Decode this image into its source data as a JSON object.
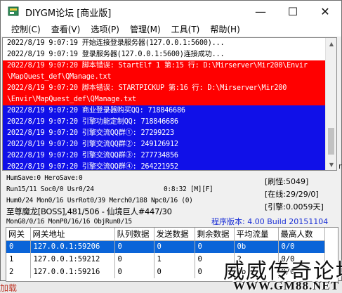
{
  "window": {
    "title": "DIYGM论坛 [商业版]",
    "controls": {
      "minimize": "—",
      "maximize": "☐",
      "close": "✕"
    }
  },
  "menu": [
    "控制(C)",
    "查看(V)",
    "选项(P)",
    "管理(M)",
    "工具(T)",
    "帮助(H)"
  ],
  "log": [
    {
      "text": "2022/8/19 9:07:19 开始连接登录服务器(127.0.0.1:5600)...",
      "style": "plain"
    },
    {
      "text": "2022/8/19 9:07:19 登录服务器(127.0.0.1:5600)连接成功...",
      "style": "plain"
    },
    {
      "text": "2022/8/19 9:07:20 脚本错误: StartElf 1 第:15 行: D:\\Mirserver\\Mir200\\Envir",
      "style": "red"
    },
    {
      "text": "\\MapQuest_def\\QManage.txt",
      "style": "red"
    },
    {
      "text": "2022/8/19 9:07:20 脚本错误: STARTPICKUP 第:16 行: D:\\Mirserver\\Mir200",
      "style": "red"
    },
    {
      "text": "\\Envir\\MapQuest_def\\QManage.txt",
      "style": "red"
    },
    {
      "text": "2022/8/19 9:07:20 商业登录器购买QQ: 718846686",
      "style": "blue"
    },
    {
      "text": "2022/8/19 9:07:20 引擎功能定制QQ: 718846686",
      "style": "blue"
    },
    {
      "text": "2022/8/19 9:07:20 引擎交流QQ群①: 27299223",
      "style": "blue"
    },
    {
      "text": "2022/8/19 9:07:20 引擎交流QQ群②: 249126912",
      "style": "blue"
    },
    {
      "text": "2022/8/19 9:07:20 引擎交流QQ群③: 277734856",
      "style": "blue"
    },
    {
      "text": "2022/8/19 9:07:20 引擎交流QQ群④: 264221952",
      "style": "blue"
    }
  ],
  "status": {
    "humsave": "HumSave:0 HeroSave:0",
    "run": "Run15/11 Soc0/0 Usr0/24",
    "time": "0:8:32 [M][F]",
    "hum": "Hum0/24 Mon0/16 UsrRot0/39 Merch0/188 Npc0/16 (0)",
    "boss": "至尊魔龙[BOSS],481/506 - 仙境巨人#447/30",
    "mongo": "MonG0/0/16 MonP0/16/16 ObjRun0/15",
    "refresh": "[刷怪:5049]",
    "online": "[在线:29/29/0]",
    "engine": "[引擎:0.0059天]",
    "version": "程序版本: 4.00 Build 20151104"
  },
  "grid": {
    "columns": [
      "网关",
      "网关地址",
      "队列数据",
      "发送数据",
      "剩余数据",
      "平均流量",
      "最高人数"
    ],
    "rows": [
      [
        "0",
        "127.0.0.1:59206",
        "0",
        "0",
        "0",
        "0b",
        "0/0"
      ],
      [
        "1",
        "127.0.0.1:59212",
        "0",
        "1",
        "0",
        "2",
        "0/0"
      ],
      [
        "2",
        "127.0.0.1:59216",
        "0",
        "0",
        "0",
        "0b",
        "0/0"
      ]
    ]
  },
  "watermark": {
    "title": "威威传奇论坛",
    "url": "WWW.GM88.NET"
  },
  "background": {
    "peek_text": "加载",
    "side_text": "m"
  }
}
